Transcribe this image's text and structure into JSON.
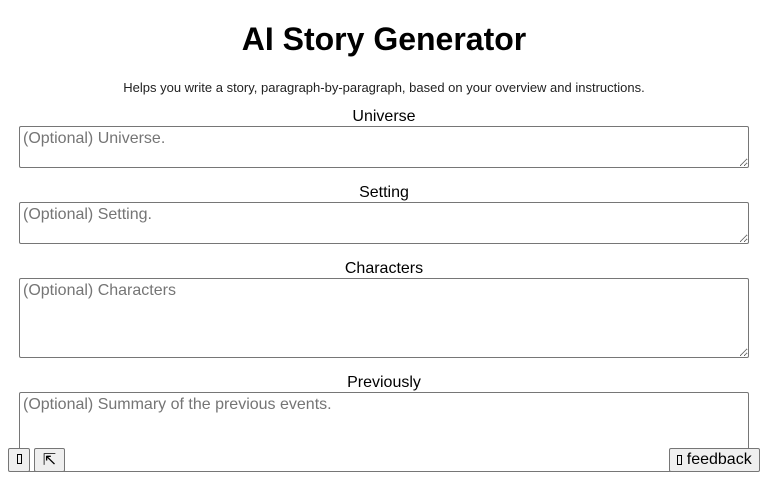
{
  "header": {
    "title": "AI Story Generator",
    "subtitle": "Helps you write a story, paragraph-by-paragraph, based on your overview and instructions."
  },
  "form": {
    "universe": {
      "label": "Universe",
      "value": "",
      "placeholder": "(Optional) Universe."
    },
    "setting": {
      "label": "Setting",
      "value": "",
      "placeholder": "(Optional) Setting."
    },
    "characters": {
      "label": "Characters",
      "value": "",
      "placeholder": "(Optional) Characters"
    },
    "previously": {
      "label": "Previously",
      "value": "",
      "placeholder": "(Optional) Summary of the previous events."
    }
  },
  "footer": {
    "left_button_1_icon": "missing-glyph-icon",
    "left_button_2_icon": "arrow-up-left-to-corner-icon",
    "left_button_2_glyph": "⇱",
    "feedback_icon": "missing-glyph-icon",
    "feedback_label": "feedback"
  }
}
